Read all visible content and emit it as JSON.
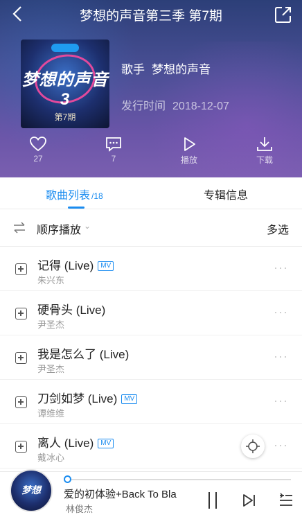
{
  "header": {
    "title": "梦想的声音第三季 第7期",
    "cover": {
      "text": "梦想的声音3",
      "episode": "第7期"
    },
    "singer_label": "歌手",
    "singer": "梦想的声音",
    "release_label": "发行时间",
    "release_date": "2018-12-07",
    "actions": {
      "like_count": "27",
      "comment_count": "7",
      "play_label": "播放",
      "download_label": "下载"
    }
  },
  "tabs": {
    "songs_label": "歌曲列表",
    "songs_count": "/18",
    "info_label": "专辑信息"
  },
  "playmode": {
    "order_label": "顺序播放",
    "multi_label": "多选"
  },
  "songs": [
    {
      "title": "记得 (Live)",
      "artist": "朱兴东",
      "badge": "MV"
    },
    {
      "title": "硬骨头 (Live)",
      "artist": "尹圣杰",
      "badge": ""
    },
    {
      "title": "我是怎么了 (Live)",
      "artist": "尹圣杰",
      "badge": ""
    },
    {
      "title": "刀剑如梦 (Live)",
      "artist": "谭维维",
      "badge": "MV"
    },
    {
      "title": "离人 (Live)",
      "artist": "戴冰心",
      "badge": "MV"
    }
  ],
  "player": {
    "title": "爱的初体验+Back To Bla",
    "artist": "林俊杰",
    "cover_text": "梦想",
    "progress": 0.0
  },
  "colors": {
    "accent": "#1a8cf0",
    "header_top": "#2c3f78",
    "header_bottom": "#7a5fb0"
  }
}
